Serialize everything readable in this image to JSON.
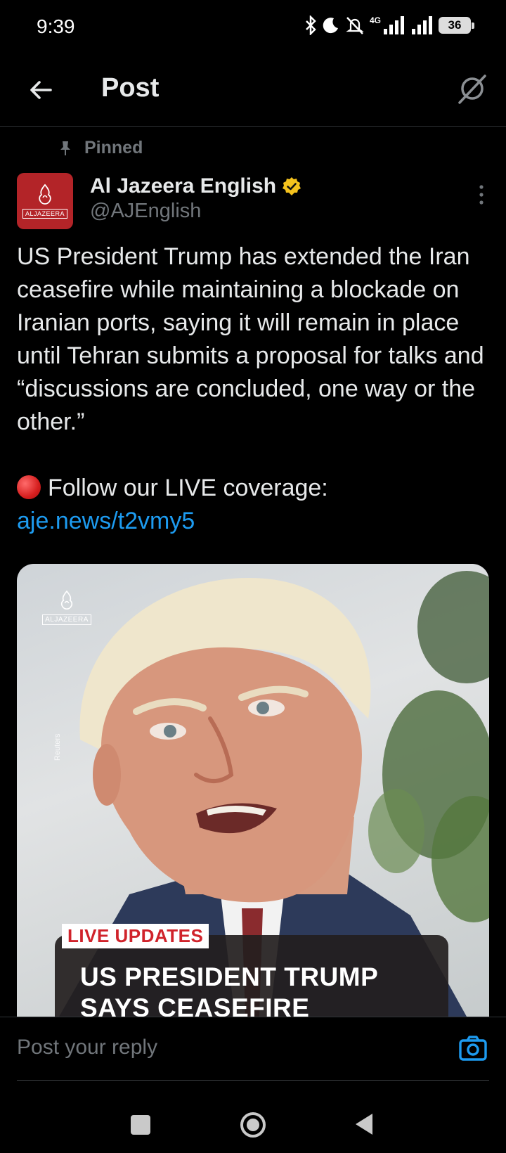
{
  "status_bar": {
    "time": "9:39",
    "network": "4G",
    "battery": "36"
  },
  "header": {
    "title": "Post"
  },
  "post": {
    "pinned_label": "Pinned",
    "author_name": "Al Jazeera English",
    "author_handle": "@AJEnglish",
    "avatar_text": "ALJAZEERA",
    "body": "US President Trump has extended the Iran ceasefire while maintaining a blockade on Iranian ports, saying it will remain in place until Tehran submits a proposal for talks and “discussions are concluded, one way or the other.”",
    "live_prefix": "Follow our LIVE coverage: ",
    "live_link": "aje.news/t2vmy5",
    "verified_color": "#f4c21d",
    "link_color": "#1d9bf0"
  },
  "media": {
    "logo_text": "ALJAZEERA",
    "credit": "Reuters",
    "tag": "LIVE UPDATES",
    "headline": "US PRESIDENT TRUMP SAYS CEASEFIRE"
  },
  "reply": {
    "placeholder": "Post your reply"
  },
  "icons": {
    "back": "arrow-left-icon",
    "grok": "grok-icon",
    "more": "more-vertical-icon",
    "camera": "camera-icon"
  }
}
